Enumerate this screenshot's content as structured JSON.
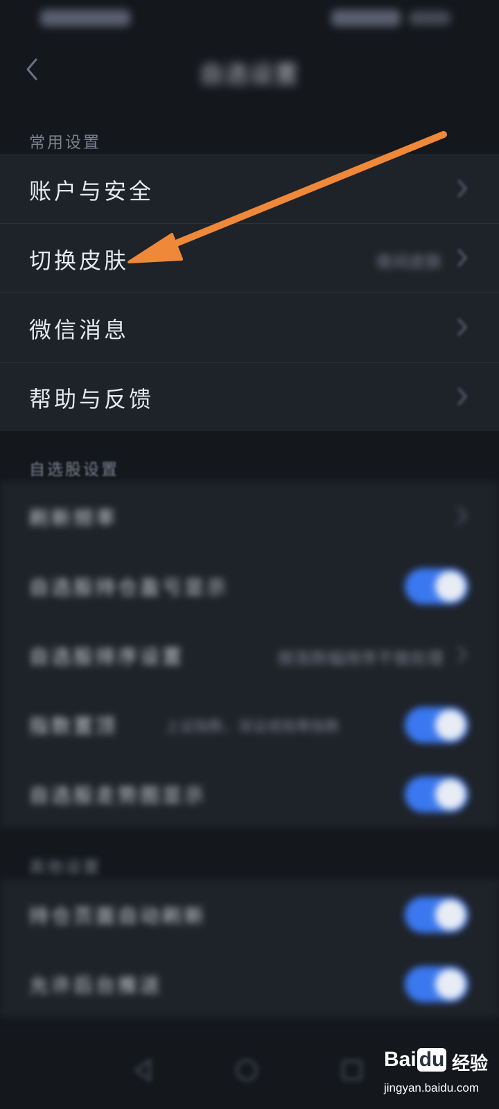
{
  "header": {
    "title": "自选设置"
  },
  "sections": {
    "common": {
      "title": "常用设置",
      "items": [
        {
          "label": "账户与安全",
          "value": ""
        },
        {
          "label": "切换皮肤",
          "value": "夜间皮肤"
        },
        {
          "label": "微信消息",
          "value": ""
        },
        {
          "label": "帮助与反馈",
          "value": ""
        }
      ]
    },
    "watchlist": {
      "title": "自选股设置",
      "items": [
        {
          "label": "刷新频率",
          "type": "link",
          "value": ""
        },
        {
          "label": "自选股持仓盈亏显示",
          "type": "toggle",
          "on": true
        },
        {
          "label": "自选股排序设置",
          "type": "link",
          "value": "按涨跌幅排序不做处理"
        },
        {
          "label": "指数置顶",
          "type": "toggle",
          "on": true,
          "sub": "上证指数、深证成指等指数"
        },
        {
          "label": "自选股走势图显示",
          "type": "toggle",
          "on": true
        }
      ]
    },
    "other": {
      "title": "其他设置",
      "items": [
        {
          "label": "持仓页面自动刷新",
          "type": "toggle",
          "on": true
        },
        {
          "label": "允许后台推送",
          "type": "toggle",
          "on": true
        }
      ]
    }
  },
  "watermark": {
    "logo_a": "Bai",
    "logo_b": "du",
    "logo_cn": "经验",
    "url": "jingyan.baidu.com"
  },
  "colors": {
    "background": "#14171c",
    "row_background": "#1e2229",
    "toggle_on": "#3a78f0",
    "annotation_arrow": "#f0883a"
  },
  "icons": {
    "back": "chevron-left-icon",
    "row_chevron": "chevron-right-icon",
    "annotation": "orange-arrow-icon"
  }
}
